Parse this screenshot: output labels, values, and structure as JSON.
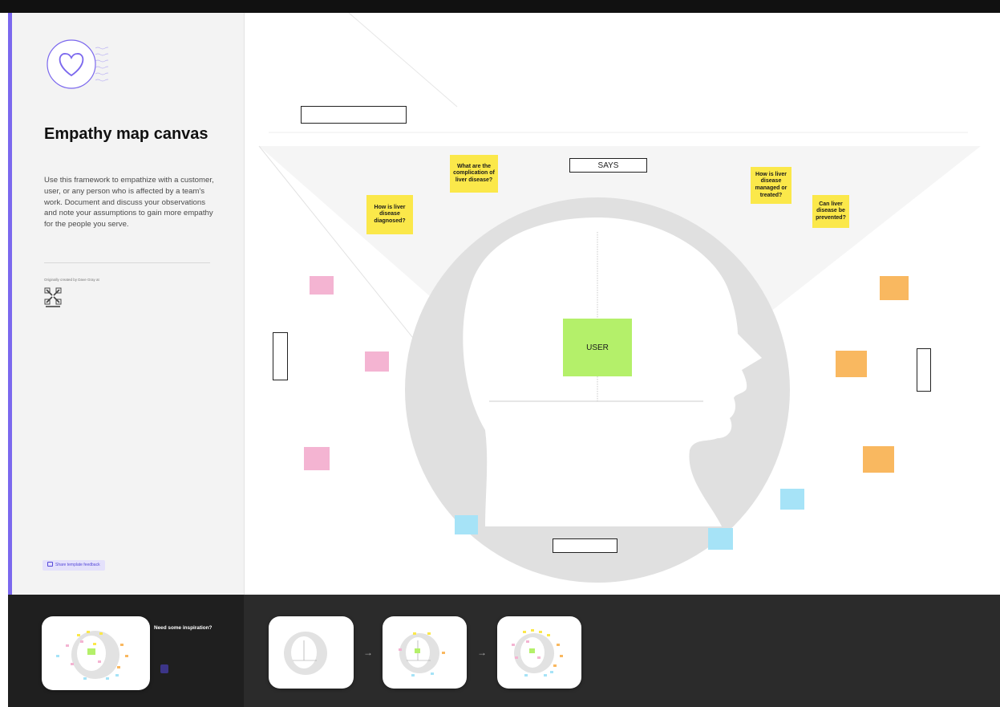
{
  "sidebar": {
    "title": "Empathy map canvas",
    "description": "Use this framework to empathize with a customer, user, or any person who is affected by a team's work. Document and discuss your observations and note your assumptions to gain more empathy for the people you serve.",
    "credit": "Originally created by Dave Gray at",
    "feedback_label": "Share template feedback"
  },
  "canvas": {
    "board_label": "",
    "says_label": "SAYS",
    "user_label": "USER",
    "yellow_notes": [
      "What are the complication of liver disease?",
      "How is liver disease diagnosed?",
      "How is liver disease managed or treated?",
      "Can liver disease be prevented?"
    ]
  },
  "bottom": {
    "inspiration_title": "Need some inspiration?",
    "inspiration_desc": "",
    "inspiration_button": ""
  },
  "colors": {
    "accent": "#7b68ee",
    "sticky_yellow": "#fbe84a",
    "sticky_pink": "#f4b4d2",
    "sticky_orange": "#f9b860",
    "sticky_blue": "#a6e3f7",
    "sticky_green": "#b4f06a"
  }
}
